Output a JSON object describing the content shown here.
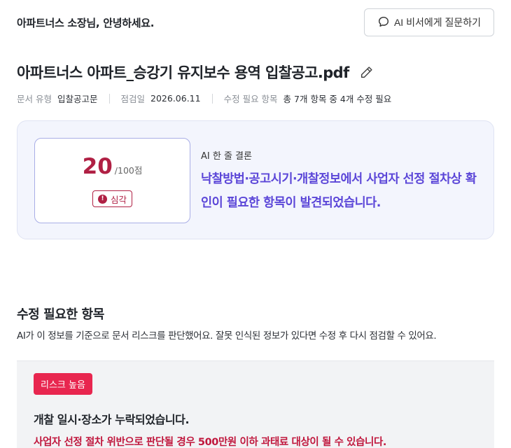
{
  "header": {
    "greeting": "아파트너스 소장님, 안녕하세요.",
    "ask_button_label": "AI 비서에게 질문하기",
    "ask_icon": "chat-bubble-icon"
  },
  "document": {
    "title": "아파트너스 아파트_승강기 유지보수 용역 입찰공고.pdf",
    "edit_icon": "pencil-icon",
    "meta": [
      {
        "label": "문서 유형",
        "value": "입찰공고문"
      },
      {
        "label": "점검일",
        "value": "2026.06.11"
      },
      {
        "label": "수정 필요 항목",
        "value": "총 7개 항목 중 4개 수정 필요"
      }
    ]
  },
  "summary": {
    "score": "20",
    "score_total": "/100점",
    "severity_label": "심각",
    "severity_icon": "alert-circle-icon",
    "ai_label": "AI 한 줄 결론",
    "ai_conclusion": "낙찰방법·공고시기·개찰정보에서 사업자 선정 절차상 확인이 필요한 항목이 발견되었습니다."
  },
  "issues_section": {
    "title": "수정 필요한 항목",
    "description": "AI가 이 정보를 기준으로 문서 리스크를 판단했어요. 잘못 인식된 정보가 있다면 수정 후 다시 점검할 수 있어요.",
    "items": [
      {
        "risk_label": "리스크 높음",
        "title": "개찰 일시·장소가 누락되었습니다.",
        "warning": "사업자 선정 절차 위반으로 판단될 경우 500만원 이하 과태료 대상이 될 수 있습니다."
      }
    ]
  },
  "colors": {
    "accent_purple": "#5b46d8",
    "danger_red": "#b02044",
    "risk_badge_red": "#e8264f"
  }
}
